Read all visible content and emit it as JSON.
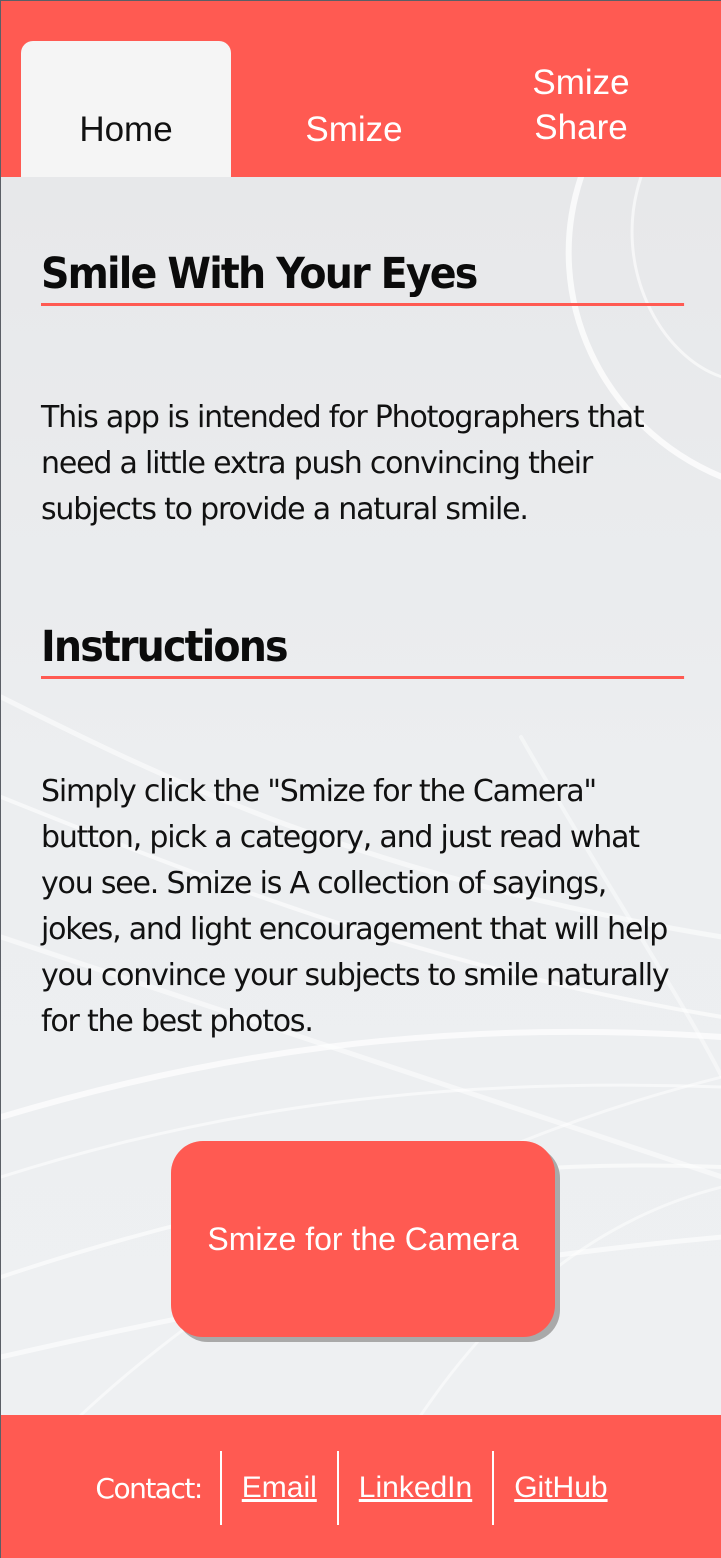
{
  "nav": {
    "tabs": [
      {
        "label": "Home",
        "active": true
      },
      {
        "label": "Smize",
        "active": false
      },
      {
        "label": "Smize Share",
        "active": false
      }
    ]
  },
  "main": {
    "section1": {
      "title": "Smile With Your Eyes",
      "text": "This app is intended for Photographers that need a little extra push convincing their subjects to provide a natural smile."
    },
    "section2": {
      "title": "Instructions",
      "text": "Simply click the \"Smize for the Camera\" button, pick a category, and just read what you see. Smize is A collection of sayings, jokes, and light encouragement that will help you convince your subjects to smile naturally for the best photos."
    },
    "cta_label": "Smize for the Camera"
  },
  "footer": {
    "contact_label": "Contact:",
    "links": [
      "Email",
      "LinkedIn",
      "GitHub"
    ]
  },
  "colors": {
    "accent": "#ff5a52",
    "active_tab": "#f5f5f5",
    "background": "#e9eaec"
  }
}
